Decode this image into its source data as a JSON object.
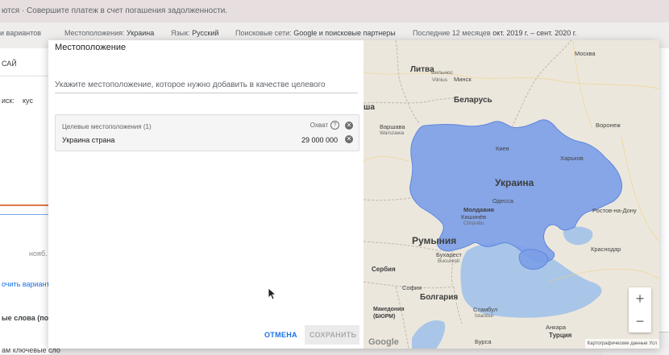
{
  "background": {
    "banner": "ются · Совершите платеж в счет погашения задолженности.",
    "filters": {
      "variants": "и вариантов",
      "location_label": "Местоположения:",
      "location_value": "Украина",
      "language_label": "Язык:",
      "language_value": "Русский",
      "networks_label": "Поисковые сети:",
      "networks_value": "Google и поисковые партнеры",
      "period_label": "Последние 12 месяцев",
      "period_value": "окт. 2019 г. – сент. 2020 г."
    },
    "left": {
      "tab": "САЙ",
      "search_label": "иск:",
      "search_chip": "кус",
      "axis_label": "нояб.",
      "get_variants": "очить вариант",
      "keywords": "ые слова (по ре",
      "keywords2": "ам ключевые сло"
    }
  },
  "dialog": {
    "title": "Местоположение",
    "search_placeholder": "Укажите местоположение, которое нужно добавить в качестве целевого",
    "targets": {
      "header": "Целевые местоположения (1)",
      "reach_header": "Охват",
      "items": [
        {
          "name": "Украина страна",
          "reach": "29 000 000"
        }
      ]
    },
    "cancel_label": "ОТМЕНА",
    "save_label": "СОХРАНИТЬ"
  },
  "map": {
    "highlight_color": "#7b9ee8",
    "water_color": "#a9c6e8",
    "land_color": "#ece7dd",
    "countries": [
      "Литва",
      "Беларусь",
      "Украина",
      "Молдавия",
      "Румыния",
      "Сербия",
      "Болгария",
      "Македония (БЮРМ)",
      "Турция",
      "ша"
    ],
    "cities": [
      "Вильнюс",
      "Vilnius",
      "Минск",
      "Москва",
      "Варшава",
      "Warszawa",
      "Киев",
      "Харьков",
      "Воронеж",
      "Кишинёв",
      "Chișinău",
      "Одесса",
      "Ростов-на-Дону",
      "Краснодар",
      "Бухарест",
      "București",
      "София",
      "Стамбул",
      "İstanbul",
      "Анкара",
      "Бурса"
    ],
    "zoom_in": "+",
    "zoom_out": "−",
    "logo": "Google",
    "attribution": "Картографические данные   Усл"
  }
}
